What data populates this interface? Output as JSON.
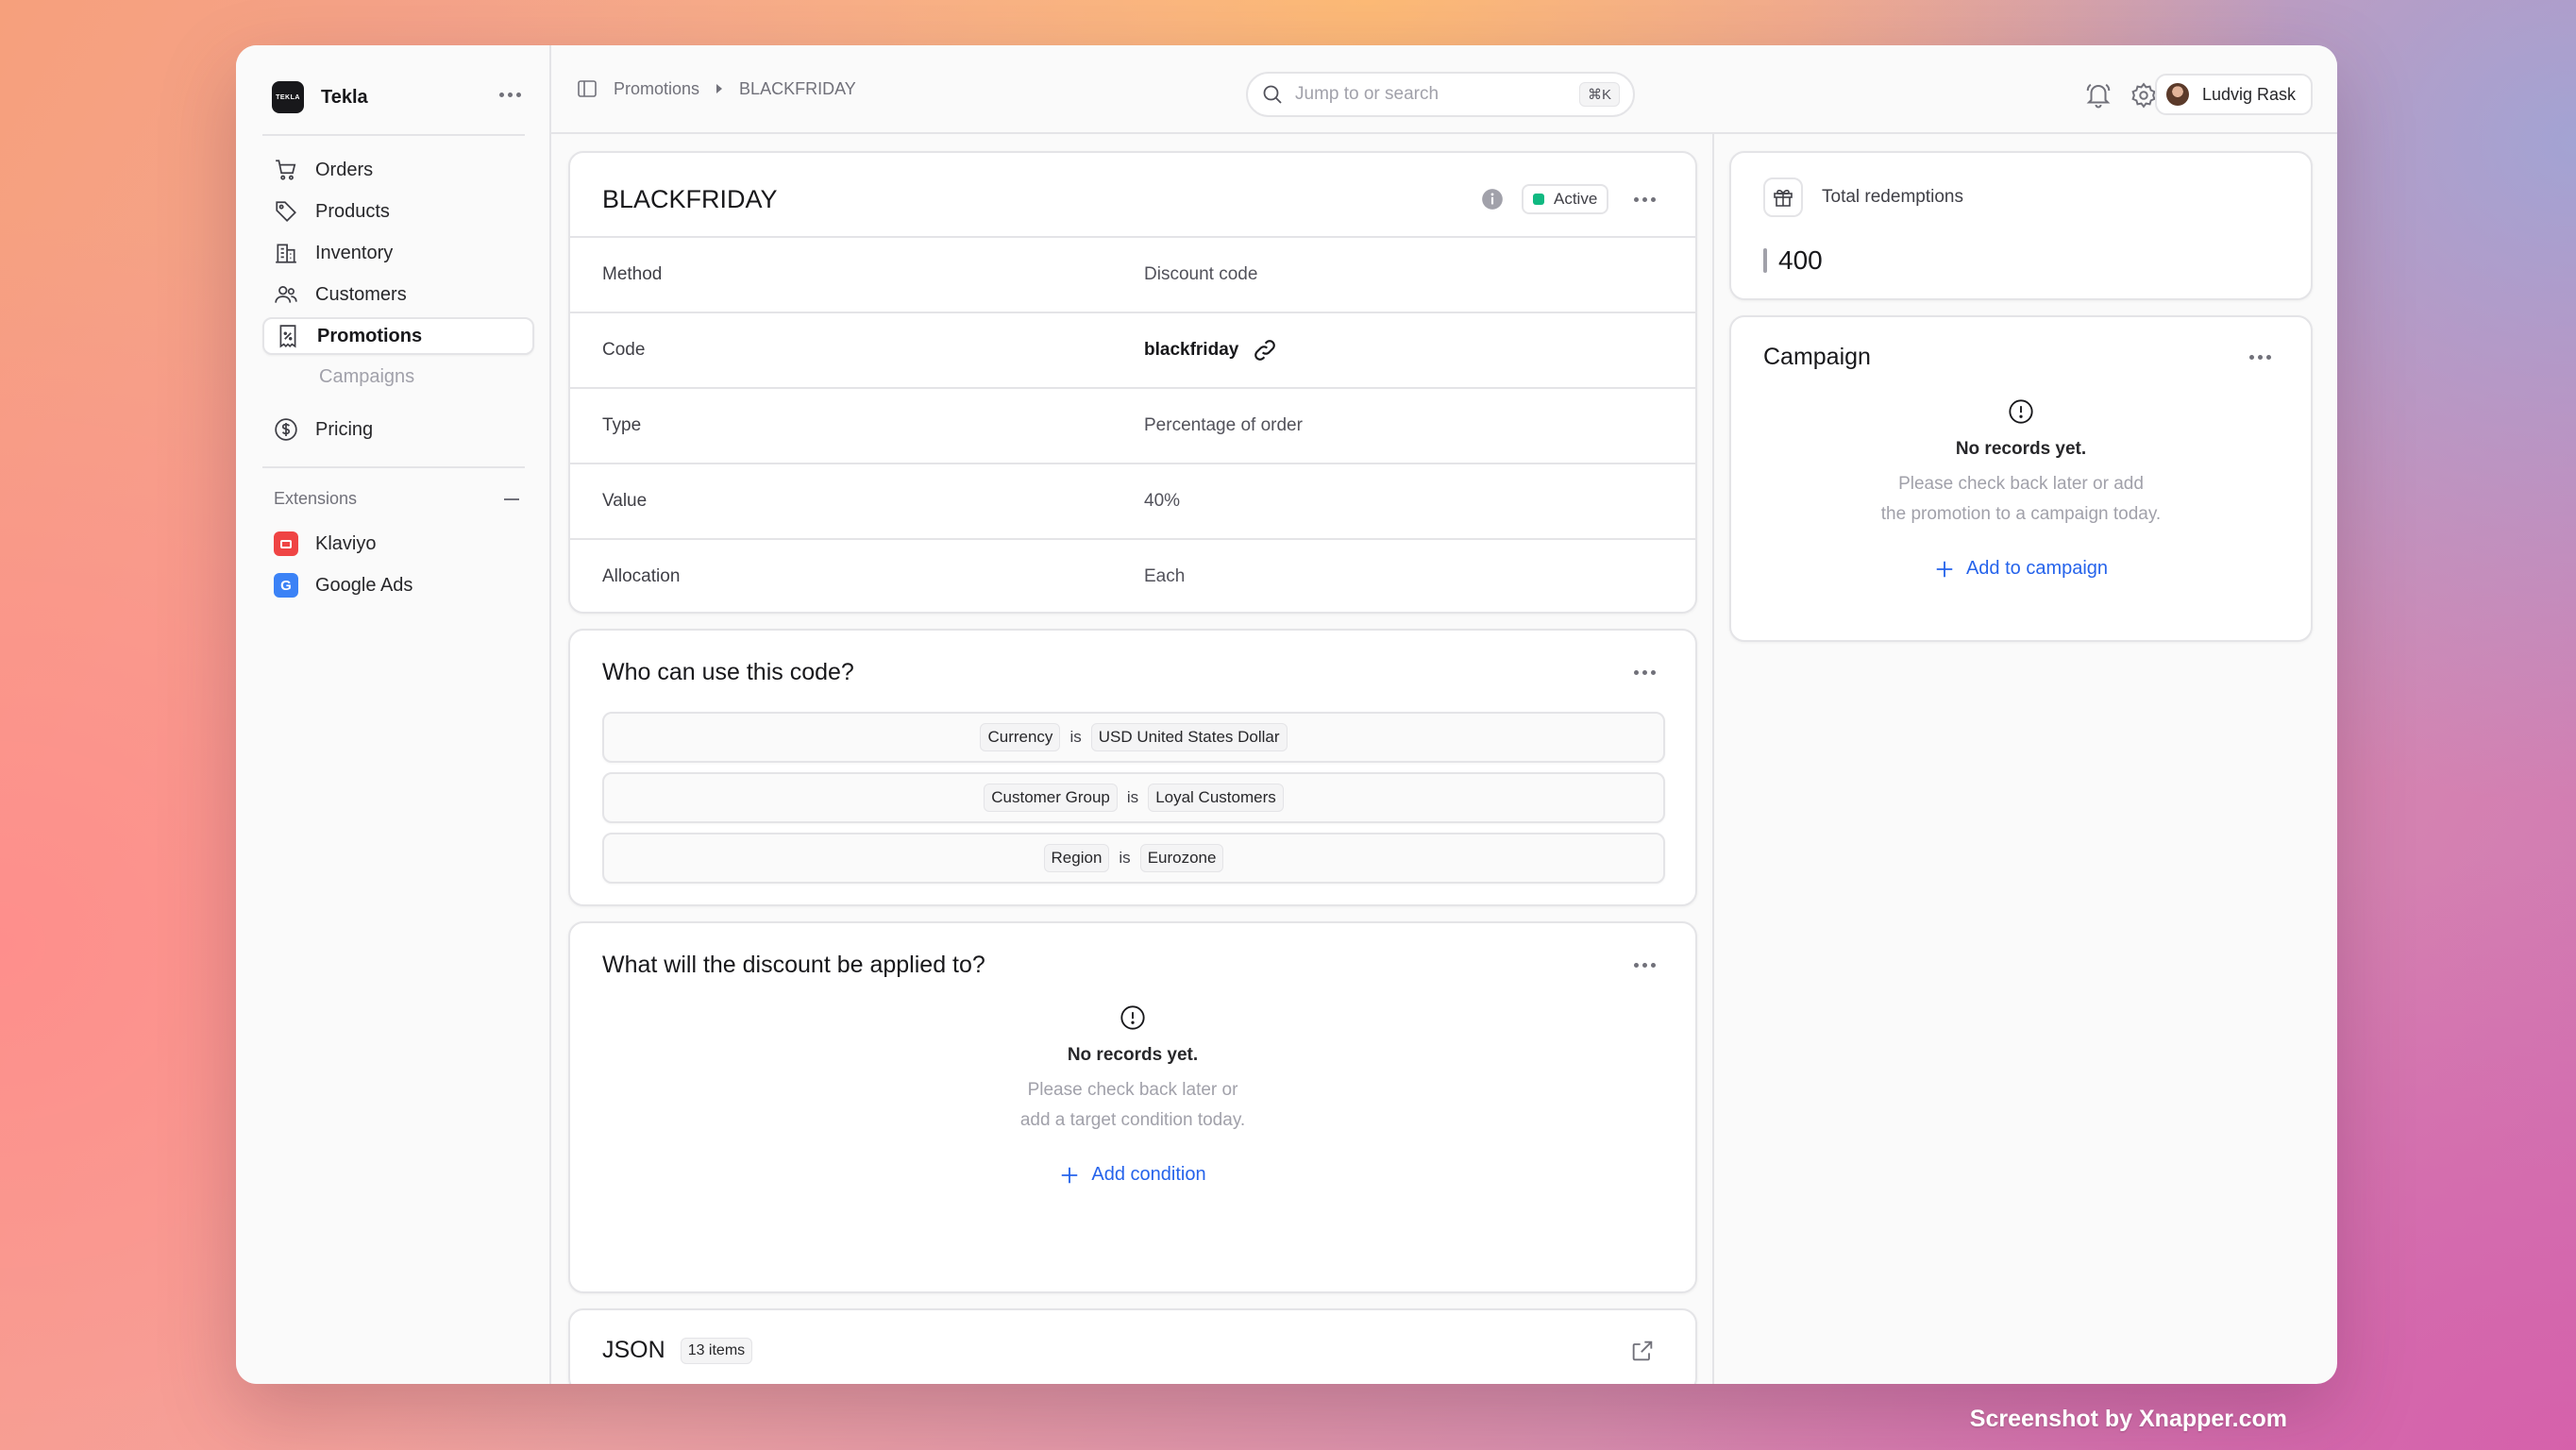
{
  "app": {
    "name": "Tekla",
    "logo_text": "TEKLA"
  },
  "sidebar": {
    "items": [
      {
        "label": "Orders",
        "icon": "cart-icon"
      },
      {
        "label": "Products",
        "icon": "tag-icon"
      },
      {
        "label": "Inventory",
        "icon": "building-icon"
      },
      {
        "label": "Customers",
        "icon": "users-icon"
      },
      {
        "label": "Promotions",
        "icon": "receipt-percent-icon",
        "active": true
      },
      {
        "label": "Campaigns",
        "sub": true
      },
      {
        "label": "Pricing",
        "icon": "currency-dollar-icon"
      }
    ],
    "extensions_label": "Extensions",
    "extensions": [
      {
        "label": "Klaviyo",
        "color": "#ef4444",
        "icon_text": ""
      },
      {
        "label": "Google Ads",
        "color": "#3b82f6",
        "icon_text": "G"
      }
    ]
  },
  "topbar": {
    "breadcrumb": [
      "Promotions",
      "BLACKFRIDAY"
    ],
    "search_placeholder": "Jump to or search",
    "shortcut": "⌘K",
    "user_name": "Ludvig Rask"
  },
  "promotion": {
    "title": "BLACKFRIDAY",
    "status": "Active",
    "status_color": "#10b981",
    "fields": [
      {
        "key": "Method",
        "value": "Discount code"
      },
      {
        "key": "Code",
        "value": "blackfriday"
      },
      {
        "key": "Type",
        "value": "Percentage of order"
      },
      {
        "key": "Value",
        "value": "40%"
      },
      {
        "key": "Allocation",
        "value": "Each"
      }
    ]
  },
  "rules": {
    "title": "Who can use this code?",
    "conditions": [
      {
        "attribute": "Currency",
        "operator": "is",
        "value": "USD United States Dollar"
      },
      {
        "attribute": "Customer Group",
        "operator": "is",
        "value": "Loyal Customers"
      },
      {
        "attribute": "Region",
        "operator": "is",
        "value": "Eurozone"
      }
    ]
  },
  "targets": {
    "title": "What will the discount be applied to?",
    "empty_title": "No records yet.",
    "empty_line1": "Please check back later or",
    "empty_line2": "add a target condition today.",
    "action": "Add condition"
  },
  "json_section": {
    "title": "JSON",
    "count": "13 items"
  },
  "redemptions": {
    "label": "Total redemptions",
    "value": "400"
  },
  "campaign": {
    "title": "Campaign",
    "empty_title": "No records yet.",
    "empty_line1": "Please check back later or add",
    "empty_line2": "the promotion to a campaign today.",
    "action": "Add to campaign"
  },
  "watermark": "Screenshot by Xnapper.com",
  "colors": {
    "accent": "#2563eb",
    "border": "#e4e4e7"
  }
}
